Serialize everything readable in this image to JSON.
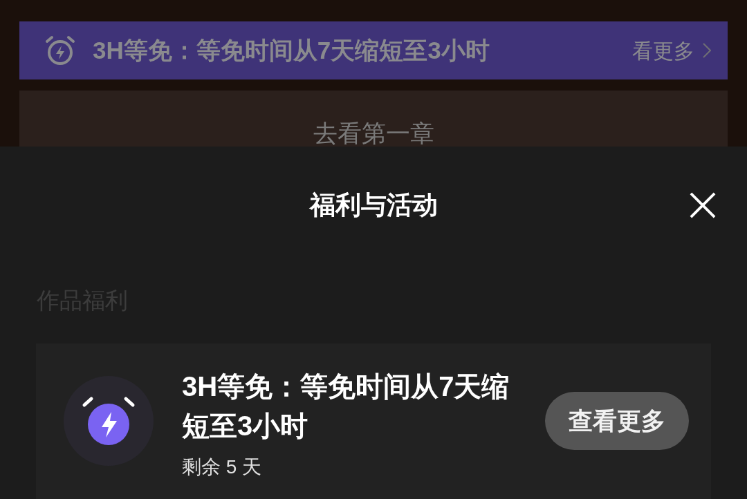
{
  "background_page": {
    "banner": {
      "title": "3H等免：等免时间从7天缩短至3小时",
      "more_link": "看更多"
    },
    "first_chapter_button": "去看第一章"
  },
  "sheet": {
    "title": "福利与活动",
    "section_title": "作品福利",
    "benefits": [
      {
        "title": "3H等免：等免时间从7天缩短至3小时",
        "remaining": "剩余 5 天",
        "button": "查看更多"
      }
    ]
  }
}
